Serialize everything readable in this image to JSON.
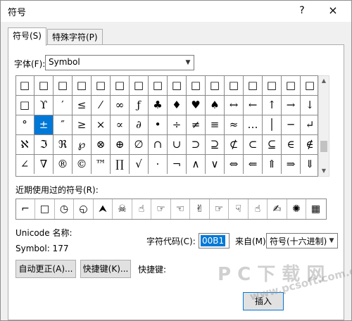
{
  "window": {
    "title": "符号",
    "help": "?",
    "close": "×"
  },
  "tabs": [
    {
      "label": "符号(S)",
      "active": true
    },
    {
      "label": "特殊字符(P)",
      "active": false
    }
  ],
  "font": {
    "label": "字体(F):",
    "value": "Symbol"
  },
  "symbol_grid": {
    "rows": [
      [
        "□",
        "□",
        "□",
        "□",
        "□",
        "□",
        "□",
        "□",
        "□",
        "□",
        "□",
        "□",
        "□",
        "□",
        "□",
        "□"
      ],
      [
        "□",
        "ϒ",
        "′",
        "≤",
        "⁄",
        "∞",
        "ƒ",
        "♣",
        "♦",
        "♥",
        "♠",
        "↔",
        "←",
        "↑",
        "→",
        "↓"
      ],
      [
        "°",
        "±",
        "″",
        "≥",
        "×",
        "∝",
        "∂",
        "•",
        "÷",
        "≠",
        "≡",
        "≈",
        "…",
        "│",
        "─",
        "↵"
      ],
      [
        "ℵ",
        "ℑ",
        "ℜ",
        "℘",
        "⊗",
        "⊕",
        "∅",
        "∩",
        "∪",
        "⊃",
        "⊇",
        "⊄",
        "⊂",
        "⊆",
        "∈",
        "∉"
      ],
      [
        "∠",
        "∇",
        "®",
        "©",
        "™",
        "∏",
        "√",
        "⋅",
        "¬",
        "∧",
        "∨",
        "⇔",
        "⇐",
        "⇑",
        "⇒",
        "⇓"
      ]
    ],
    "selected": {
      "row": 2,
      "col": 1
    }
  },
  "recent": {
    "label": "近期使用过的符号(R):",
    "items": [
      "⌐",
      "□",
      "◷",
      "◵",
      "⮝",
      "☠",
      "☝",
      "☞",
      "☜",
      "✌",
      "☞",
      "☟",
      "☝",
      "✍",
      "✺",
      "▦"
    ]
  },
  "unicode_name_label": "Unicode 名称:",
  "symbol_code": "Symbol: 177",
  "char_code": {
    "label": "字符代码(C):",
    "value": "00B1"
  },
  "from": {
    "label": "来自(M):",
    "value": "符号(十六进制)"
  },
  "buttons": {
    "autocorrect": "自动更正(A)...",
    "shortcut_key": "快捷键(K)...",
    "shortcut_label": "快捷键:",
    "insert": "插入"
  },
  "watermark": {
    "text1": "P C 下 载 网",
    "text2": "www.pcsoft.com.cn"
  }
}
